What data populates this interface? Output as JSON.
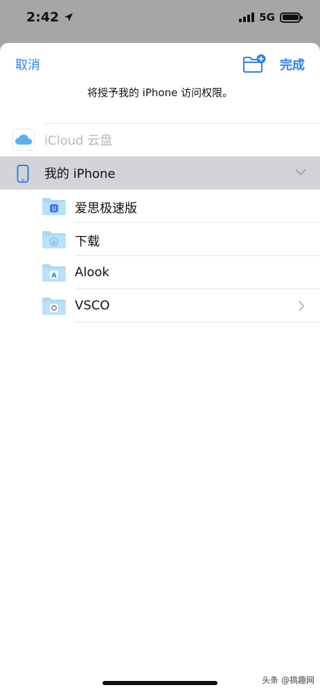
{
  "status_bar": {
    "time": "2:42",
    "network": "5G"
  },
  "nav": {
    "cancel_label": "取消",
    "done_label": "完成",
    "prompt": "将授予我的 iPhone 访问权限。"
  },
  "locations": {
    "icloud_label": "iCloud 云盘",
    "iphone_label": "我的 iPhone"
  },
  "folders": [
    {
      "name": "爱思极速版",
      "icon": "aisi-folder-icon"
    },
    {
      "name": "下载",
      "icon": "download-folder-icon"
    },
    {
      "name": "Alook",
      "icon": "alook-folder-icon"
    },
    {
      "name": "VSCO",
      "icon": "vsco-folder-icon",
      "has_children": true
    }
  ],
  "watermark": "头条 @搞趣网",
  "colors": {
    "accent": "#2a7ff5",
    "folder": "#a9d8f7",
    "selected_row": "#d3d3d8",
    "backdrop": "#a6a6a9"
  }
}
